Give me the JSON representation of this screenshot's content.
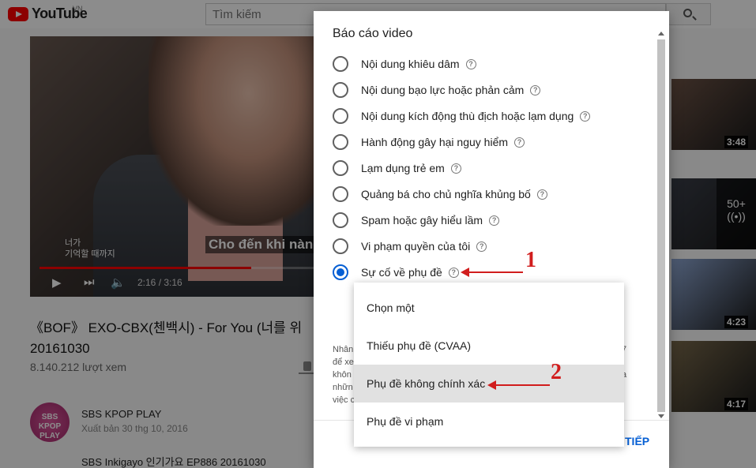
{
  "youtube": {
    "logo_text": "YouTube",
    "region": "VN",
    "search_placeholder": "Tìm kiếm"
  },
  "player": {
    "caption_main": "Cho đến khi nàng",
    "caption_small_1": "너가",
    "caption_small_2": "기억할 때까지",
    "time": "2:16 / 3:16",
    "progress_fraction": 0.69
  },
  "video": {
    "title": "《BOF》 EXO-CBX(첸백시) - For You (너를 위 20161030",
    "views": "8.140.212 lượt xem"
  },
  "channel": {
    "avatar_text_1": "SBS",
    "avatar_text_2": "KPOP",
    "avatar_text_3": "PLAY",
    "name": "SBS KPOP PLAY",
    "published": "Xuất bản 30 thg 10, 2016",
    "description": "SBS Inkigayo 인기가요 EP886 20161030"
  },
  "sidebar": {
    "thumbs": [
      {
        "duration": "3:48",
        "color": "#6d5346"
      },
      {
        "overlay_count": "50+",
        "color": "#3a3e48"
      },
      {
        "duration": "4:23",
        "color": "#8fa8d4"
      },
      {
        "duration": "4:17",
        "color": "#7a6a4c"
      }
    ]
  },
  "dialog": {
    "title": "Báo cáo video",
    "options": [
      {
        "label": "Nội dung khiêu dâm",
        "checked": false
      },
      {
        "label": "Nội dung bạo lực hoặc phản cảm",
        "checked": false
      },
      {
        "label": "Nội dung kích động thù địch hoặc lạm dụng",
        "checked": false
      },
      {
        "label": "Hành động gây hại nguy hiểm",
        "checked": false
      },
      {
        "label": "Lạm dụng trẻ em",
        "checked": false
      },
      {
        "label": "Quảng bá cho chủ nghĩa khủng bố",
        "checked": false
      },
      {
        "label": "Spam hoặc gây hiểu lầm",
        "checked": false
      },
      {
        "label": "Vi phạm quyền của tôi",
        "checked": false
      },
      {
        "label": "Sự cố về phụ đề",
        "checked": true
      }
    ],
    "help_glyph": "?",
    "desc_left": [
      "Nhân",
      "để xe",
      "khôn",
      "nhữn",
      "việc c"
    ],
    "desc_right": [
      "7",
      "",
      "a"
    ],
    "next_label": "TIẾP"
  },
  "dropdown": {
    "items": [
      {
        "label": "Chọn một",
        "active": false
      },
      {
        "label": "Thiếu phụ đề (CVAA)",
        "active": false
      },
      {
        "label": "Phụ đề không chính xác",
        "active": true
      },
      {
        "label": "Phụ đề vi phạm",
        "active": false
      }
    ]
  },
  "annotations": {
    "label_1": "1",
    "label_2": "2",
    "color": "#d11d1d"
  },
  "colors": {
    "accent": "#065fd4",
    "youtube_red": "#ff0000"
  }
}
